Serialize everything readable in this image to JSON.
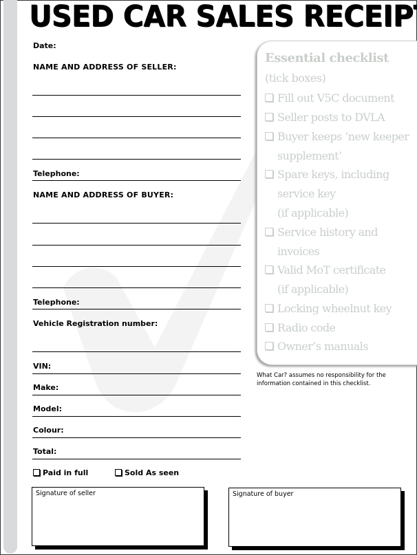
{
  "title": "USED CAR SALES RECEIPT",
  "form": {
    "date_label": "Date:",
    "seller_heading": "NAME AND ADDRESS OF SELLER:",
    "seller_telephone_label": "Telephone:",
    "buyer_heading": "NAME AND ADDRESS OF BUYER:",
    "buyer_telephone_label": "Telephone:",
    "vehicle_registration_label": "Vehicle Registration number:",
    "vin_label": "VIN:",
    "make_label": "Make:",
    "model_label": "Model:",
    "colour_label": "Colour:",
    "total_label": "Total:",
    "paid_in_full_label": "Paid in full",
    "sold_as_seen_label": "Sold As seen"
  },
  "checklist": {
    "title": "Essential checklist",
    "subtitle": "(tick boxes)",
    "items": [
      {
        "lines": [
          "Fill out V5C document"
        ]
      },
      {
        "lines": [
          "Seller posts to DVLA"
        ]
      },
      {
        "lines": [
          "Buyer keeps ‘new keeper",
          "supplement’"
        ]
      },
      {
        "lines": [
          "Spare keys, including",
          "service key",
          "(if applicable)"
        ]
      },
      {
        "lines": [
          "Service history and",
          "invoices"
        ]
      },
      {
        "lines": [
          "Valid MoT certificate",
          "(if applicable)"
        ]
      },
      {
        "lines": [
          "Locking wheelnut key"
        ]
      },
      {
        "lines": [
          "Radio code"
        ]
      },
      {
        "lines": [
          "Owner’s manuals"
        ]
      }
    ],
    "disclaimer_line1": "What Car? assumes no responsibility for the",
    "disclaimer_line2": "information contained in this checklist."
  },
  "signatures": {
    "seller_label": "Signature of seller",
    "buyer_label": "Signature of buyer"
  },
  "colors": {
    "checklist_text": "#c8cfca",
    "side_bar": "#d9dadc",
    "ink": "#000000"
  }
}
